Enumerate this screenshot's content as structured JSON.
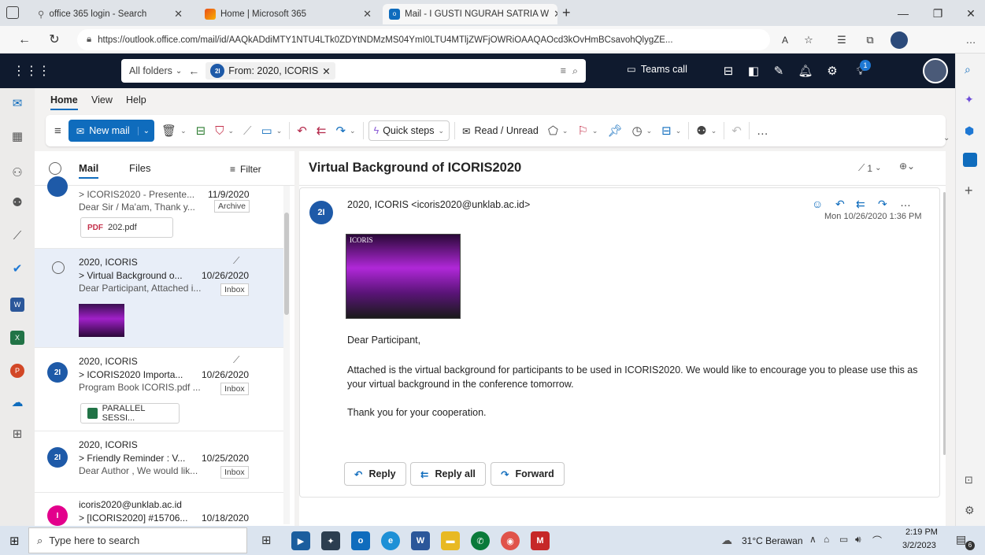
{
  "browser": {
    "tabs": [
      {
        "title": "office 365 login - Search"
      },
      {
        "title": "Home | Microsoft 365"
      },
      {
        "title": "Mail - I GUSTI NGURAH SATRIA W"
      }
    ],
    "url": "https://outlook.office.com/mail/id/AAQkADdiMTY1NTU4LTk0ZDYtNDMzMS04YmI0LTU4MTljZWFjOWRiOAAQAOcd3kOvHmBCsavohQlygZE..."
  },
  "outlook": {
    "search": {
      "folder": "All folders",
      "filter_avatar": "2I",
      "filter_label": "From: 2020, ICORIS"
    },
    "teams_call": "Teams call",
    "notification_count": "1",
    "ribbon_tabs": [
      "Home",
      "View",
      "Help"
    ],
    "ribbon": {
      "new_mail": "New mail",
      "quick_steps": "Quick steps",
      "read_unread": "Read / Unread"
    },
    "list": {
      "tabs": [
        "Mail",
        "Files"
      ],
      "filter": "Filter",
      "items": [
        {
          "sender": "",
          "subject": "> ICORIS2020 - Presente...",
          "date": "11/9/2020",
          "preview": "Dear Sir / Ma'am, Thank y...",
          "folder": "Archive",
          "attachment": "202.pdf"
        },
        {
          "sender": "2020, ICORIS",
          "subject": "> Virtual Background o...",
          "date": "10/26/2020",
          "preview": "Dear Participant, Attached i...",
          "folder": "Inbox"
        },
        {
          "sender": "2020, ICORIS",
          "avatar": "2I",
          "subject": "> ICORIS2020 Importa...",
          "date": "10/26/2020",
          "preview": "Program Book ICORIS.pdf ...",
          "folder": "Inbox",
          "attachment": "PARALLEL SESSI..."
        },
        {
          "sender": "2020, ICORIS",
          "avatar": "2I",
          "subject": "> Friendly Reminder : V...",
          "date": "10/25/2020",
          "preview": "Dear Author , We would lik...",
          "folder": "Inbox"
        },
        {
          "sender": "icoris2020@unklab.ac.id",
          "avatar": "I",
          "subject": "> [ICORIS2020] #15706...",
          "date": "10/18/2020"
        }
      ]
    },
    "reading": {
      "subject": "Virtual Background of ICORIS2020",
      "attachment_count": "1",
      "avatar": "2I",
      "from": "2020, ICORIS <icoris2020@unklab.ac.id>",
      "datetime": "Mon 10/26/2020 1:36 PM",
      "image_label": "ICORIS",
      "body": [
        "Dear Participant,",
        "Attached is the virtual background for participants to be used in ICORIS2020.  We would like to encourage you to please use this as your virtual background in the conference tomorrow.",
        "Thank you for your cooperation."
      ],
      "actions": {
        "reply": "Reply",
        "reply_all": "Reply all",
        "forward": "Forward"
      }
    }
  },
  "taskbar": {
    "search_placeholder": "Type here to search",
    "weather": "31°C  Berawan",
    "time": "2:19 PM",
    "date": "3/2/2023",
    "notif_count": "6"
  },
  "colors": {
    "outlook_dark": "#0f1a2e",
    "accent": "#0f6cbd",
    "avatar_blue": "#1e5aa8",
    "avatar_pink": "#e3008c"
  }
}
